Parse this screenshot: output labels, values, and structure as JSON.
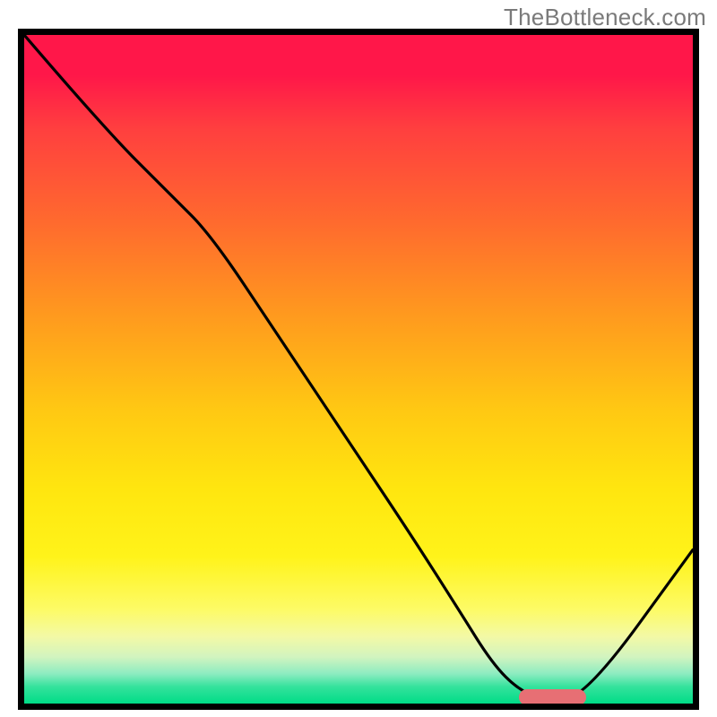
{
  "watermark": "TheBottleneck.com",
  "chart_data": {
    "type": "line",
    "title": "",
    "xlabel": "",
    "ylabel": "",
    "xlim": [
      0,
      100
    ],
    "ylim": [
      0,
      100
    ],
    "grid": false,
    "legend": false,
    "annotations": [],
    "series": [
      {
        "name": "bottleneck-curve",
        "x": [
          0,
          12,
          22,
          28,
          38,
          48,
          58,
          65,
          70,
          74,
          78,
          84,
          100
        ],
        "values": [
          100,
          86,
          76,
          70,
          55,
          40,
          25,
          14,
          6,
          2,
          0.5,
          1,
          23
        ]
      }
    ],
    "optimal_marker": {
      "x_start": 74,
      "x_end": 84,
      "y": 1
    },
    "gradient_meaning": "red=high bottleneck, green=optimal"
  },
  "colors": {
    "curve": "#000000",
    "marker": "#e76f74",
    "border": "#000000",
    "watermark": "#7a7a7a"
  }
}
